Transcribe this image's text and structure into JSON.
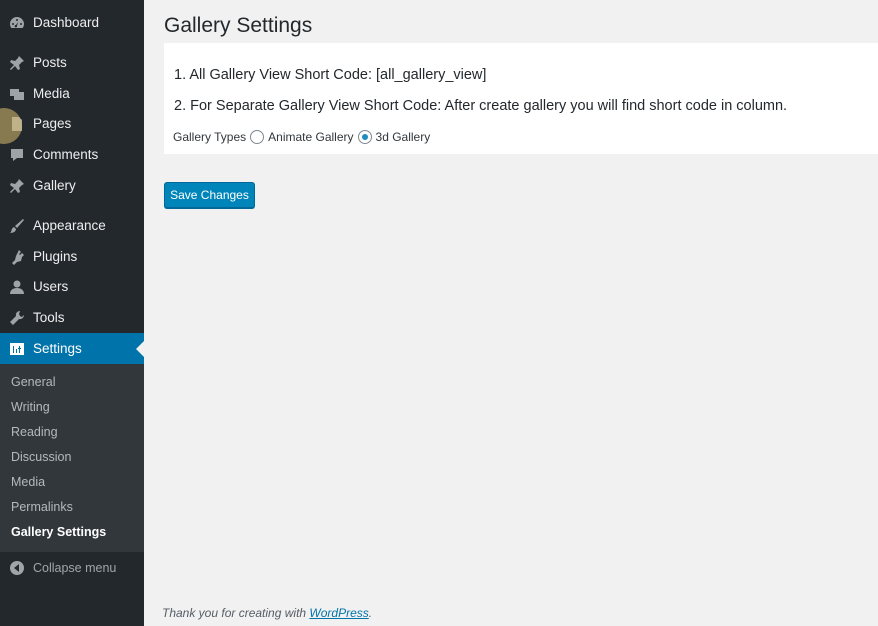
{
  "sidebar": {
    "items": [
      {
        "label": "Dashboard",
        "icon": "dashboard-icon"
      },
      {
        "label": "Posts",
        "icon": "pin-icon"
      },
      {
        "label": "Media",
        "icon": "media-icon"
      },
      {
        "label": "Pages",
        "icon": "pages-icon"
      },
      {
        "label": "Comments",
        "icon": "comment-icon"
      },
      {
        "label": "Gallery",
        "icon": "pin-icon"
      },
      {
        "label": "Appearance",
        "icon": "brush-icon"
      },
      {
        "label": "Plugins",
        "icon": "plugin-icon"
      },
      {
        "label": "Users",
        "icon": "user-icon"
      },
      {
        "label": "Tools",
        "icon": "wrench-icon"
      },
      {
        "label": "Settings",
        "icon": "settings-icon"
      }
    ],
    "submenu": [
      "General",
      "Writing",
      "Reading",
      "Discussion",
      "Media",
      "Permalinks",
      "Gallery Settings"
    ],
    "collapse_label": "Collapse menu"
  },
  "main": {
    "title": "Gallery Settings",
    "line1": "1. All Gallery View Short Code: [all_gallery_view]",
    "line2": "2. For Separate Gallery View Short Code: After create gallery you will find short code in column.",
    "gallery_types_label": "Gallery Types",
    "options": [
      {
        "label": "Animate Gallery",
        "checked": false
      },
      {
        "label": "3d Gallery",
        "checked": true
      }
    ],
    "save_label": "Save Changes"
  },
  "footer": {
    "text": "Thank you for creating with ",
    "link": "WordPress",
    "end": "."
  },
  "colors": {
    "sidebar": "#23282d",
    "submenu": "#32373c",
    "accent": "#0073aa",
    "button": "#0085ba"
  }
}
